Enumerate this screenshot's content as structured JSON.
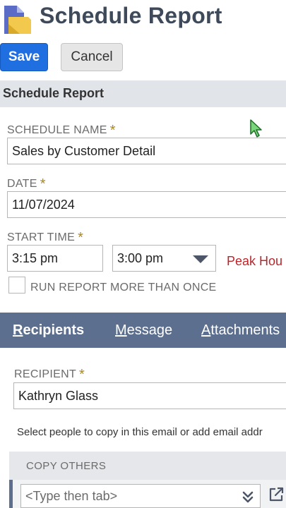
{
  "header": {
    "title": "Schedule Report"
  },
  "toolbar": {
    "save_label": "Save",
    "cancel_label": "Cancel"
  },
  "section": {
    "title": "Schedule Report"
  },
  "form": {
    "schedule_name": {
      "label": "SCHEDULE NAME",
      "required_mark": "*",
      "value": "Sales by Customer Detail"
    },
    "date": {
      "label": "DATE",
      "required_mark": "*",
      "value": "11/07/2024"
    },
    "start_time": {
      "label": "START TIME",
      "required_mark": "*",
      "value": "3:15 pm",
      "select_value": "3:00 pm",
      "note": "Peak Hou"
    },
    "run_more_than_once": {
      "label": "RUN REPORT MORE THAN ONCE",
      "checked": false
    }
  },
  "tabs": [
    {
      "label": "Recipients",
      "underline_char": "R",
      "rest": "ecipients",
      "active": true
    },
    {
      "label": "Message",
      "underline_char": "M",
      "rest": "essage",
      "active": false
    },
    {
      "label": "Attachments",
      "underline_char": "A",
      "rest": "ttachments",
      "active": false
    }
  ],
  "recipients": {
    "recipient_label": "RECIPIENT",
    "required_mark": "*",
    "recipient_value": "Kathryn Glass",
    "helper_text": "Select people to copy in this email or add email addr",
    "copy_others_label": "COPY OTHERS",
    "copy_input_placeholder": "<Type then tab>"
  },
  "colors": {
    "save_button": "#1f6fe0",
    "tabs_bar": "#5c6f8e",
    "required_mark": "#a8872f",
    "peak_note": "#b9262b",
    "title": "#3e4a5a"
  },
  "icons": {
    "report": "report-icon",
    "cursor": "cursor-icon",
    "dropdown": "chevron-down-icon",
    "list": "double-chevron-down-icon",
    "open": "external-link-icon"
  }
}
